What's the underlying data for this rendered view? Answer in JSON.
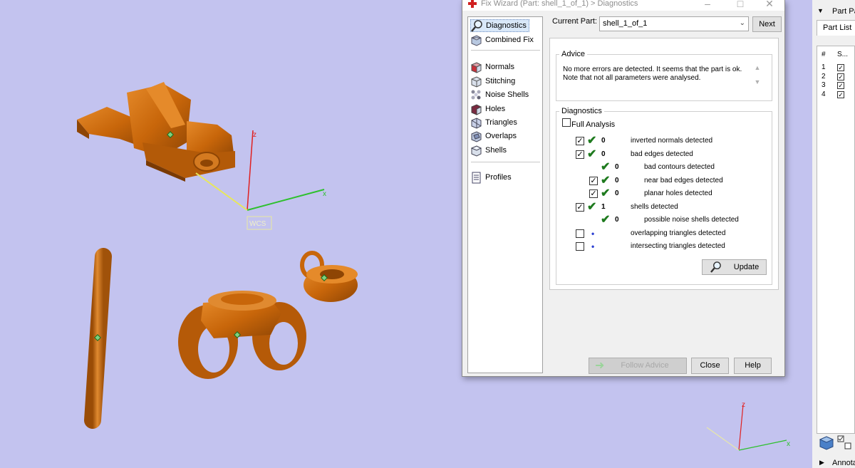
{
  "dialog": {
    "title": "Fix Wizard (Part: shell_1_of_1) > Diagnostics",
    "nav": [
      {
        "label": "Diagnostics",
        "icon": "magnifier-icon",
        "selected": true
      },
      {
        "label": "Combined Fix",
        "icon": "combined-fix-icon"
      },
      {
        "label": "Normals",
        "icon": "normals-icon"
      },
      {
        "label": "Stitching",
        "icon": "stitching-icon"
      },
      {
        "label": "Noise Shells",
        "icon": "noise-shells-icon"
      },
      {
        "label": "Holes",
        "icon": "holes-icon"
      },
      {
        "label": "Triangles",
        "icon": "triangles-icon"
      },
      {
        "label": "Overlaps",
        "icon": "overlaps-icon"
      },
      {
        "label": "Shells",
        "icon": "shells-icon"
      },
      {
        "label": "Profiles",
        "icon": "profiles-icon"
      }
    ],
    "current_part_label": "Current Part:",
    "current_part_value": "shell_1_of_1",
    "next_label": "Next",
    "advice": {
      "legend": "Advice",
      "line1": "No more errors are detected. It seems that the part is ok.",
      "line2": "Note that not all parameters were analysed."
    },
    "diagnostics": {
      "legend": "Diagnostics",
      "full_analysis_label": "Full Analysis",
      "full_analysis_checked": false,
      "rows": [
        {
          "checked": true,
          "status": "ok",
          "count": "0",
          "label": "inverted normals detected"
        },
        {
          "checked": true,
          "status": "ok",
          "count": "0",
          "label": "bad edges detected"
        },
        {
          "checked": null,
          "status": "ok",
          "count": "0",
          "label": "bad contours detected"
        },
        {
          "checked": true,
          "status": "ok",
          "count": "0",
          "label": "near bad edges detected"
        },
        {
          "checked": true,
          "status": "ok",
          "count": "0",
          "label": "planar holes detected"
        },
        {
          "checked": true,
          "status": "ok",
          "count": "1",
          "label": "shells detected"
        },
        {
          "checked": null,
          "status": "ok",
          "count": "0",
          "label": "possible noise shells detected"
        },
        {
          "checked": false,
          "status": "pending",
          "count": "",
          "label": "overlapping triangles detected"
        },
        {
          "checked": false,
          "status": "pending",
          "count": "",
          "label": "intersecting triangles detected"
        }
      ]
    },
    "update_label": "Update",
    "follow_advice_label": "Follow Advice",
    "close_label": "Close",
    "help_label": "Help"
  },
  "viewport": {
    "axis_x": "x",
    "axis_z": "z",
    "wcs_label": "WCS",
    "object_color": "#c8660a",
    "background_color": "#c3c3ef"
  },
  "part_panel": {
    "title": "Part Pa",
    "tab": "Part List",
    "col_num": "#",
    "col_s": "S...",
    "rows": [
      "1",
      "2",
      "3",
      "4"
    ],
    "annotations_label": "Annota"
  }
}
